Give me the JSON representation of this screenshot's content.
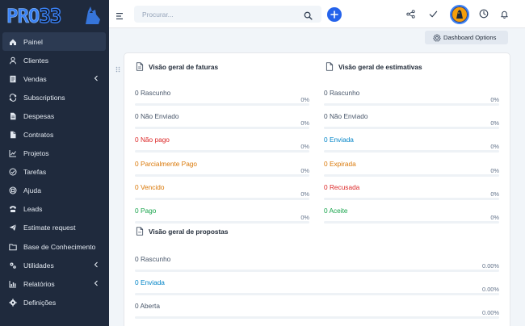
{
  "brand": {
    "logo_text": "PRO33"
  },
  "sidebar": {
    "items": [
      {
        "label": "Painel",
        "icon": "home-icon",
        "active": true,
        "chevron": false
      },
      {
        "label": "Clientes",
        "icon": "user-icon",
        "active": false,
        "chevron": false
      },
      {
        "label": "Vendas",
        "icon": "receipt-icon",
        "active": false,
        "chevron": true
      },
      {
        "label": "Subscriptions",
        "icon": "repeat-icon",
        "active": false,
        "chevron": false
      },
      {
        "label": "Despesas",
        "icon": "file-text-icon",
        "active": false,
        "chevron": false
      },
      {
        "label": "Contratos",
        "icon": "contract-icon",
        "active": false,
        "chevron": false
      },
      {
        "label": "Projetos",
        "icon": "chart-icon",
        "active": false,
        "chevron": false
      },
      {
        "label": "Tarefas",
        "icon": "check-circle-icon",
        "active": false,
        "chevron": false
      },
      {
        "label": "Ajuda",
        "icon": "lifebuoy-icon",
        "active": false,
        "chevron": false
      },
      {
        "label": "Leads",
        "icon": "tty-icon",
        "active": false,
        "chevron": false
      },
      {
        "label": "Estimate request",
        "icon": "paper-plane-icon",
        "active": false,
        "chevron": false
      },
      {
        "label": "Base de Conhecimento",
        "icon": "folder-icon",
        "active": false,
        "chevron": false
      },
      {
        "label": "Utilidades",
        "icon": "cogs-icon",
        "active": false,
        "chevron": true
      },
      {
        "label": "Relatórios",
        "icon": "bar-chart-icon",
        "active": false,
        "chevron": true
      },
      {
        "label": "Definições",
        "icon": "gear-icon",
        "active": false,
        "chevron": false
      }
    ]
  },
  "header": {
    "search_placeholder": "Procurar..."
  },
  "dashboard_options_label": "Dashboard Options",
  "invoices": {
    "title": "Visão geral de faturas",
    "rows": [
      {
        "count": "0",
        "label": "Rascunho",
        "pct": "0%",
        "value": 0,
        "color": "gray"
      },
      {
        "count": "0",
        "label": "Não Enviado",
        "pct": "0%",
        "value": 0,
        "color": "gray"
      },
      {
        "count": "0",
        "label": "Não pago",
        "pct": "0%",
        "value": 0,
        "color": "red"
      },
      {
        "count": "0",
        "label": "Parcialmente Pago",
        "pct": "0%",
        "value": 0,
        "color": "orange"
      },
      {
        "count": "0",
        "label": "Vencido",
        "pct": "0%",
        "value": 0,
        "color": "orange"
      },
      {
        "count": "0",
        "label": "Pago",
        "pct": "0%",
        "value": 0,
        "color": "green"
      }
    ]
  },
  "estimates": {
    "title": "Visão geral de estimativas",
    "rows": [
      {
        "count": "0",
        "label": "Rascunho",
        "pct": "0%",
        "value": 0,
        "color": "gray"
      },
      {
        "count": "0",
        "label": "Não Enviado",
        "pct": "0%",
        "value": 0,
        "color": "gray"
      },
      {
        "count": "0",
        "label": "Enviada",
        "pct": "0%",
        "value": 0,
        "color": "blue"
      },
      {
        "count": "0",
        "label": "Expirada",
        "pct": "0%",
        "value": 0,
        "color": "orange"
      },
      {
        "count": "0",
        "label": "Recusada",
        "pct": "0%",
        "value": 0,
        "color": "red"
      },
      {
        "count": "0",
        "label": "Aceite",
        "pct": "0%",
        "value": 0,
        "color": "green"
      }
    ]
  },
  "proposals": {
    "title": "Visão geral de propostas",
    "rows": [
      {
        "count": "0",
        "label": "Rascunho",
        "pct": "0.00%",
        "value": 0,
        "color": "gray"
      },
      {
        "count": "0",
        "label": "Enviada",
        "pct": "0.00%",
        "value": 0,
        "color": "blue"
      },
      {
        "count": "0",
        "label": "Aberta",
        "pct": "0.00%",
        "value": 0,
        "color": "gray"
      }
    ]
  },
  "colors": {
    "sidebar_bg": "#1f2a3d",
    "accent": "#2563eb",
    "gray": "#475569",
    "red": "#dc2626",
    "orange": "#d97706",
    "green": "#16a34a",
    "blue": "#0284c7"
  }
}
